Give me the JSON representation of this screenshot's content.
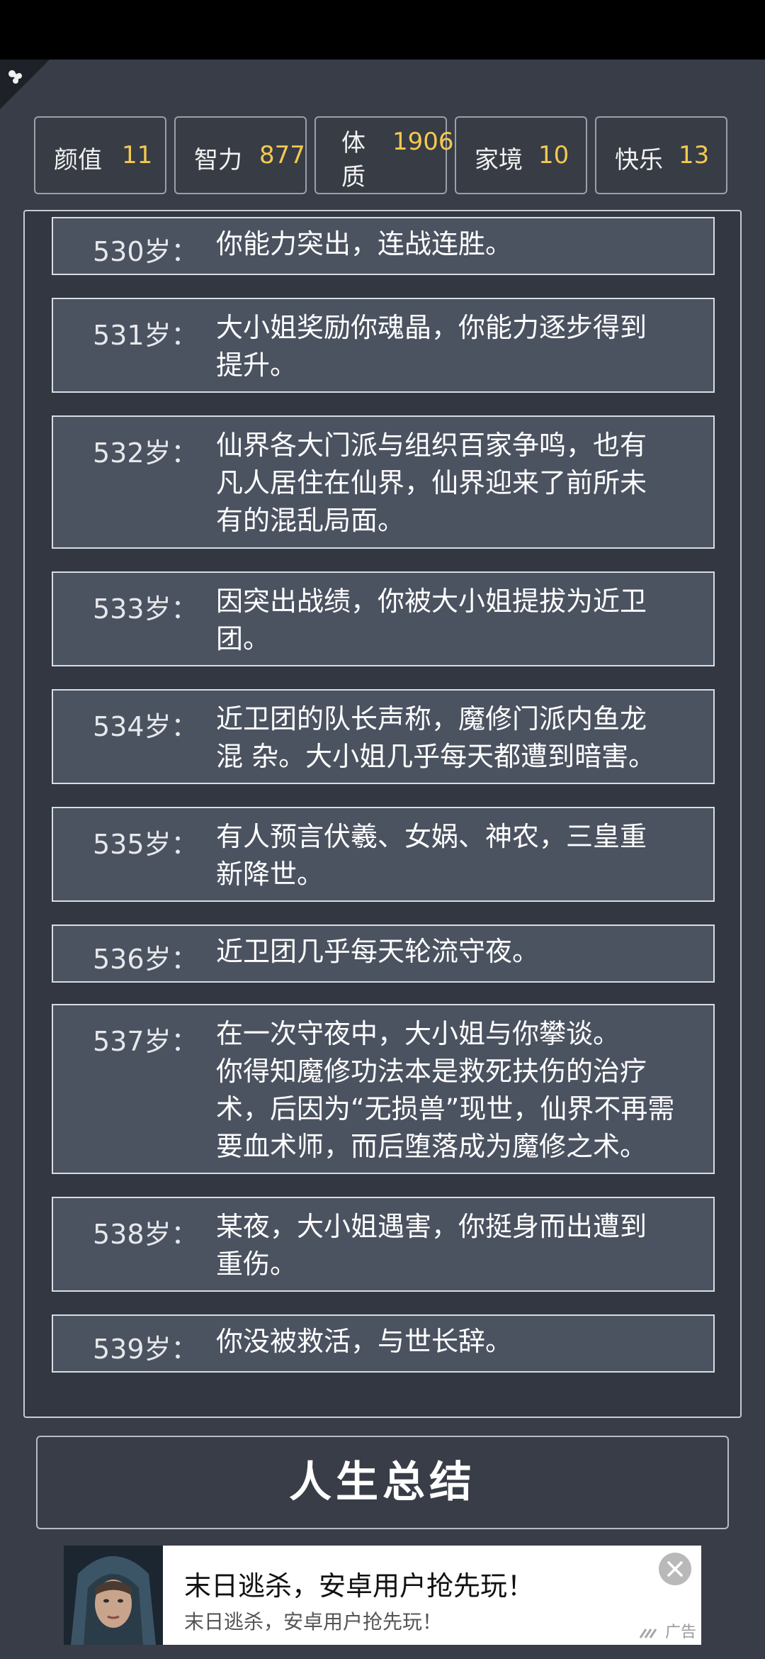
{
  "stats": [
    {
      "name": "颜值",
      "value": "11"
    },
    {
      "name": "智力",
      "value": "877"
    },
    {
      "name": "体质",
      "value": "1906"
    },
    {
      "name": "家境",
      "value": "10"
    },
    {
      "name": "快乐",
      "value": "13"
    }
  ],
  "log": [
    {
      "age": "530岁：",
      "text": "你能力突出，连战连胜。"
    },
    {
      "age": "531岁：",
      "text": "大小姐奖励你魂晶，你能力逐步得到\n提升。"
    },
    {
      "age": "532岁：",
      "text": "仙界各大门派与组织百家争鸣，也有\n凡人居住在仙界，仙界迎来了前所未\n有的混乱局面。"
    },
    {
      "age": "533岁：",
      "text": "因突出战绩，你被大小姐提拔为近卫\n团。"
    },
    {
      "age": "534岁：",
      "text": "近卫团的队长声称，魔修门派内鱼龙\n混 杂。大小姐几乎每天都遭到暗害。"
    },
    {
      "age": "535岁：",
      "text": "有人预言伏羲、女娲、神农，三皇重\n新降世。"
    },
    {
      "age": "536岁：",
      "text": "近卫团几乎每天轮流守夜。"
    },
    {
      "age": "537岁：",
      "text": "在一次守夜中，大小姐与你攀谈。\n你得知魔修功法本是救死扶伤的治疗\n术，后因为“无损兽”现世，仙界不再需\n要血术师，而后堕落成为魔修之术。"
    },
    {
      "age": "538岁：",
      "text": "某夜，大小姐遇害，你挺身而出遭到\n重伤。"
    },
    {
      "age": "539岁：",
      "text": "你没被救活，与世长辞。"
    }
  ],
  "summary_button": "人生总结",
  "ad": {
    "title": "末日逃杀，安卓用户抢先玩！",
    "subtitle": "末日逃杀，安卓用户抢先玩！",
    "label": "广告"
  }
}
